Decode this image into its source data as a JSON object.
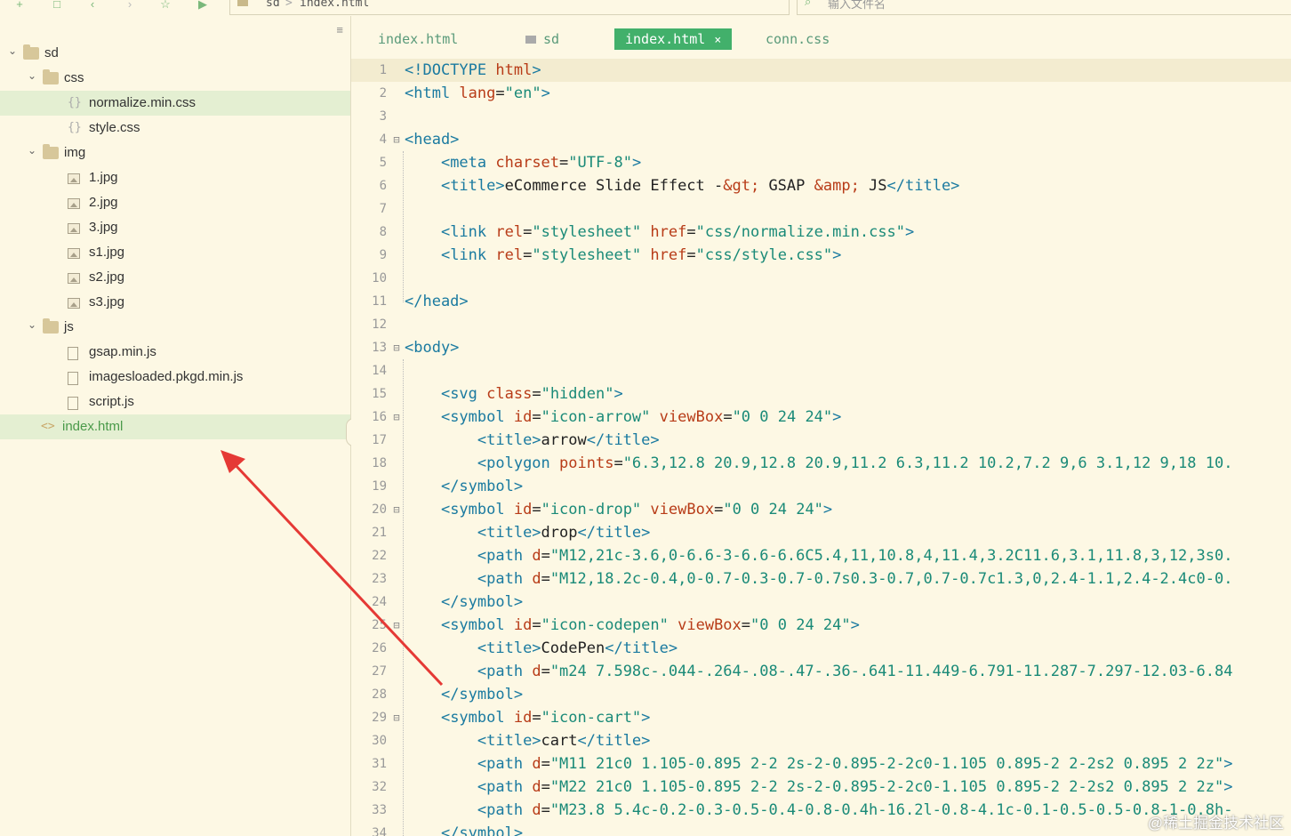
{
  "toolbar": {
    "icons": [
      "add-file-icon",
      "new-window-icon",
      "back-icon",
      "forward-icon",
      "star-icon",
      "run-icon"
    ]
  },
  "breadcrumb": {
    "folder": "sd",
    "separator": ">",
    "file": "index.html"
  },
  "search": {
    "placeholder": "输入文件名"
  },
  "sidebar": {
    "menu_icon": "≡",
    "tree": [
      {
        "label": "sd",
        "type": "folder",
        "expanded": true
      },
      {
        "label": "css",
        "type": "folder",
        "expanded": true
      },
      {
        "label": "normalize.min.css",
        "type": "css",
        "selected": true
      },
      {
        "label": "style.css",
        "type": "css"
      },
      {
        "label": "img",
        "type": "folder",
        "expanded": true
      },
      {
        "label": "1.jpg",
        "type": "image"
      },
      {
        "label": "2.jpg",
        "type": "image"
      },
      {
        "label": "3.jpg",
        "type": "image"
      },
      {
        "label": "s1.jpg",
        "type": "image"
      },
      {
        "label": "s2.jpg",
        "type": "image"
      },
      {
        "label": "s3.jpg",
        "type": "image"
      },
      {
        "label": "js",
        "type": "folder",
        "expanded": true
      },
      {
        "label": "gsap.min.js",
        "type": "js"
      },
      {
        "label": "imagesloaded.pkgd.min.js",
        "type": "js"
      },
      {
        "label": "script.js",
        "type": "js"
      },
      {
        "label": "index.html",
        "type": "html",
        "active": true
      }
    ]
  },
  "tabs": [
    {
      "label": "index.html"
    },
    {
      "label": "sd",
      "folder": true
    },
    {
      "label": "index.html",
      "active": true,
      "close": "×"
    },
    {
      "label": "conn.css"
    }
  ],
  "editor": {
    "lines": [
      {
        "n": "1",
        "tokens": [
          [
            "t",
            "<!DOCTYPE "
          ],
          [
            "a",
            "html"
          ],
          [
            "t",
            ">"
          ]
        ]
      },
      {
        "n": "2",
        "tokens": [
          [
            "t",
            "<html "
          ],
          [
            "a",
            "lang"
          ],
          [
            "x",
            "="
          ],
          [
            "v",
            "\"en\""
          ],
          [
            "t",
            ">"
          ]
        ]
      },
      {
        "n": "3",
        "tokens": []
      },
      {
        "n": "4",
        "fold": "⊟",
        "tokens": [
          [
            "t",
            "<head>"
          ]
        ]
      },
      {
        "n": "5",
        "tokens": [
          [
            "x",
            "    "
          ],
          [
            "t",
            "<meta "
          ],
          [
            "a",
            "charset"
          ],
          [
            "x",
            "="
          ],
          [
            "v",
            "\"UTF-8\""
          ],
          [
            "t",
            ">"
          ]
        ]
      },
      {
        "n": "6",
        "tokens": [
          [
            "x",
            "    "
          ],
          [
            "t",
            "<title>"
          ],
          [
            "x",
            "eCommerce Slide Effect -"
          ],
          [
            "e",
            "&gt;"
          ],
          [
            "x",
            " GSAP "
          ],
          [
            "e",
            "&amp;"
          ],
          [
            "x",
            " JS"
          ],
          [
            "t",
            "</title>"
          ]
        ]
      },
      {
        "n": "7",
        "tokens": []
      },
      {
        "n": "8",
        "tokens": [
          [
            "x",
            "    "
          ],
          [
            "t",
            "<link "
          ],
          [
            "a",
            "rel"
          ],
          [
            "x",
            "="
          ],
          [
            "v",
            "\"stylesheet\""
          ],
          [
            "x",
            " "
          ],
          [
            "a",
            "href"
          ],
          [
            "x",
            "="
          ],
          [
            "v",
            "\"css/normalize.min.css\""
          ],
          [
            "t",
            ">"
          ]
        ]
      },
      {
        "n": "9",
        "tokens": [
          [
            "x",
            "    "
          ],
          [
            "t",
            "<link "
          ],
          [
            "a",
            "rel"
          ],
          [
            "x",
            "="
          ],
          [
            "v",
            "\"stylesheet\""
          ],
          [
            "x",
            " "
          ],
          [
            "a",
            "href"
          ],
          [
            "x",
            "="
          ],
          [
            "v",
            "\"css/style.css\""
          ],
          [
            "t",
            ">"
          ]
        ]
      },
      {
        "n": "10",
        "tokens": []
      },
      {
        "n": "11",
        "tokens": [
          [
            "t",
            "</head>"
          ]
        ]
      },
      {
        "n": "12",
        "tokens": []
      },
      {
        "n": "13",
        "fold": "⊟",
        "tokens": [
          [
            "t",
            "<body>"
          ]
        ]
      },
      {
        "n": "14",
        "tokens": []
      },
      {
        "n": "15",
        "tokens": [
          [
            "x",
            "    "
          ],
          [
            "t",
            "<svg "
          ],
          [
            "a",
            "class"
          ],
          [
            "x",
            "="
          ],
          [
            "v",
            "\"hidden\""
          ],
          [
            "t",
            ">"
          ]
        ]
      },
      {
        "n": "16",
        "fold": "⊟",
        "tokens": [
          [
            "x",
            "    "
          ],
          [
            "t",
            "<symbol "
          ],
          [
            "a",
            "id"
          ],
          [
            "x",
            "="
          ],
          [
            "v",
            "\"icon-arrow\""
          ],
          [
            "x",
            " "
          ],
          [
            "a",
            "viewBox"
          ],
          [
            "x",
            "="
          ],
          [
            "v",
            "\"0 0 24 24\""
          ],
          [
            "t",
            ">"
          ]
        ]
      },
      {
        "n": "17",
        "tokens": [
          [
            "x",
            "        "
          ],
          [
            "t",
            "<title>"
          ],
          [
            "x",
            "arrow"
          ],
          [
            "t",
            "</title>"
          ]
        ]
      },
      {
        "n": "18",
        "tokens": [
          [
            "x",
            "        "
          ],
          [
            "t",
            "<polygon "
          ],
          [
            "a",
            "points"
          ],
          [
            "x",
            "="
          ],
          [
            "v",
            "\"6.3,12.8 20.9,12.8 20.9,11.2 6.3,11.2 10.2,7.2 9,6 3.1,12 9,18 10."
          ]
        ]
      },
      {
        "n": "19",
        "tokens": [
          [
            "x",
            "    "
          ],
          [
            "t",
            "</symbol>"
          ]
        ]
      },
      {
        "n": "20",
        "fold": "⊟",
        "tokens": [
          [
            "x",
            "    "
          ],
          [
            "t",
            "<symbol "
          ],
          [
            "a",
            "id"
          ],
          [
            "x",
            "="
          ],
          [
            "v",
            "\"icon-drop\""
          ],
          [
            "x",
            " "
          ],
          [
            "a",
            "viewBox"
          ],
          [
            "x",
            "="
          ],
          [
            "v",
            "\"0 0 24 24\""
          ],
          [
            "t",
            ">"
          ]
        ]
      },
      {
        "n": "21",
        "tokens": [
          [
            "x",
            "        "
          ],
          [
            "t",
            "<title>"
          ],
          [
            "x",
            "drop"
          ],
          [
            "t",
            "</title>"
          ]
        ]
      },
      {
        "n": "22",
        "tokens": [
          [
            "x",
            "        "
          ],
          [
            "t",
            "<path "
          ],
          [
            "a",
            "d"
          ],
          [
            "x",
            "="
          ],
          [
            "v",
            "\"M12,21c-3.6,0-6.6-3-6.6-6.6C5.4,11,10.8,4,11.4,3.2C11.6,3.1,11.8,3,12,3s0."
          ]
        ]
      },
      {
        "n": "23",
        "tokens": [
          [
            "x",
            "        "
          ],
          [
            "t",
            "<path "
          ],
          [
            "a",
            "d"
          ],
          [
            "x",
            "="
          ],
          [
            "v",
            "\"M12,18.2c-0.4,0-0.7-0.3-0.7-0.7s0.3-0.7,0.7-0.7c1.3,0,2.4-1.1,2.4-2.4c0-0."
          ]
        ]
      },
      {
        "n": "24",
        "tokens": [
          [
            "x",
            "    "
          ],
          [
            "t",
            "</symbol>"
          ]
        ]
      },
      {
        "n": "25",
        "fold": "⊟",
        "tokens": [
          [
            "x",
            "    "
          ],
          [
            "t",
            "<symbol "
          ],
          [
            "a",
            "id"
          ],
          [
            "x",
            "="
          ],
          [
            "v",
            "\"icon-codepen\""
          ],
          [
            "x",
            " "
          ],
          [
            "a",
            "viewBox"
          ],
          [
            "x",
            "="
          ],
          [
            "v",
            "\"0 0 24 24\""
          ],
          [
            "t",
            ">"
          ]
        ]
      },
      {
        "n": "26",
        "tokens": [
          [
            "x",
            "        "
          ],
          [
            "t",
            "<title>"
          ],
          [
            "x",
            "CodePen"
          ],
          [
            "t",
            "</title>"
          ]
        ]
      },
      {
        "n": "27",
        "tokens": [
          [
            "x",
            "        "
          ],
          [
            "t",
            "<path "
          ],
          [
            "a",
            "d"
          ],
          [
            "x",
            "="
          ],
          [
            "v",
            "\"m24 7.598c-.044-.264-.08-.47-.36-.641-11.449-6.791-11.287-7.297-12.03-6.84"
          ]
        ]
      },
      {
        "n": "28",
        "tokens": [
          [
            "x",
            "    "
          ],
          [
            "t",
            "</symbol>"
          ]
        ]
      },
      {
        "n": "29",
        "fold": "⊟",
        "tokens": [
          [
            "x",
            "    "
          ],
          [
            "t",
            "<symbol "
          ],
          [
            "a",
            "id"
          ],
          [
            "x",
            "="
          ],
          [
            "v",
            "\"icon-cart\""
          ],
          [
            "t",
            ">"
          ]
        ]
      },
      {
        "n": "30",
        "tokens": [
          [
            "x",
            "        "
          ],
          [
            "t",
            "<title>"
          ],
          [
            "x",
            "cart"
          ],
          [
            "t",
            "</title>"
          ]
        ]
      },
      {
        "n": "31",
        "tokens": [
          [
            "x",
            "        "
          ],
          [
            "t",
            "<path "
          ],
          [
            "a",
            "d"
          ],
          [
            "x",
            "="
          ],
          [
            "v",
            "\"M11 21c0 1.105-0.895 2-2 2s-2-0.895-2-2c0-1.105 0.895-2 2-2s2 0.895 2 2z\""
          ],
          [
            "t",
            ">"
          ]
        ]
      },
      {
        "n": "32",
        "tokens": [
          [
            "x",
            "        "
          ],
          [
            "t",
            "<path "
          ],
          [
            "a",
            "d"
          ],
          [
            "x",
            "="
          ],
          [
            "v",
            "\"M22 21c0 1.105-0.895 2-2 2s-2-0.895-2-2c0-1.105 0.895-2 2-2s2 0.895 2 2z\""
          ],
          [
            "t",
            ">"
          ]
        ]
      },
      {
        "n": "33",
        "tokens": [
          [
            "x",
            "        "
          ],
          [
            "t",
            "<path "
          ],
          [
            "a",
            "d"
          ],
          [
            "x",
            "="
          ],
          [
            "v",
            "\"M23.8 5.4c-0.2-0.3-0.5-0.4-0.8-0.4h-16.2l-0.8-4.1c-0.1-0.5-0.5-0.8-1-0.8h-"
          ]
        ]
      },
      {
        "n": "34",
        "tokens": [
          [
            "x",
            "    "
          ],
          [
            "t",
            "</symbol>"
          ]
        ]
      }
    ]
  },
  "watermark": "@稀土掘金技术社区",
  "colors": {
    "background": "#fdf8e4",
    "active_tab": "#42b06b",
    "tag": "#1a7aa0",
    "attribute": "#b83c18",
    "value": "#1a8a78",
    "annotation_arrow": "#e53935"
  }
}
